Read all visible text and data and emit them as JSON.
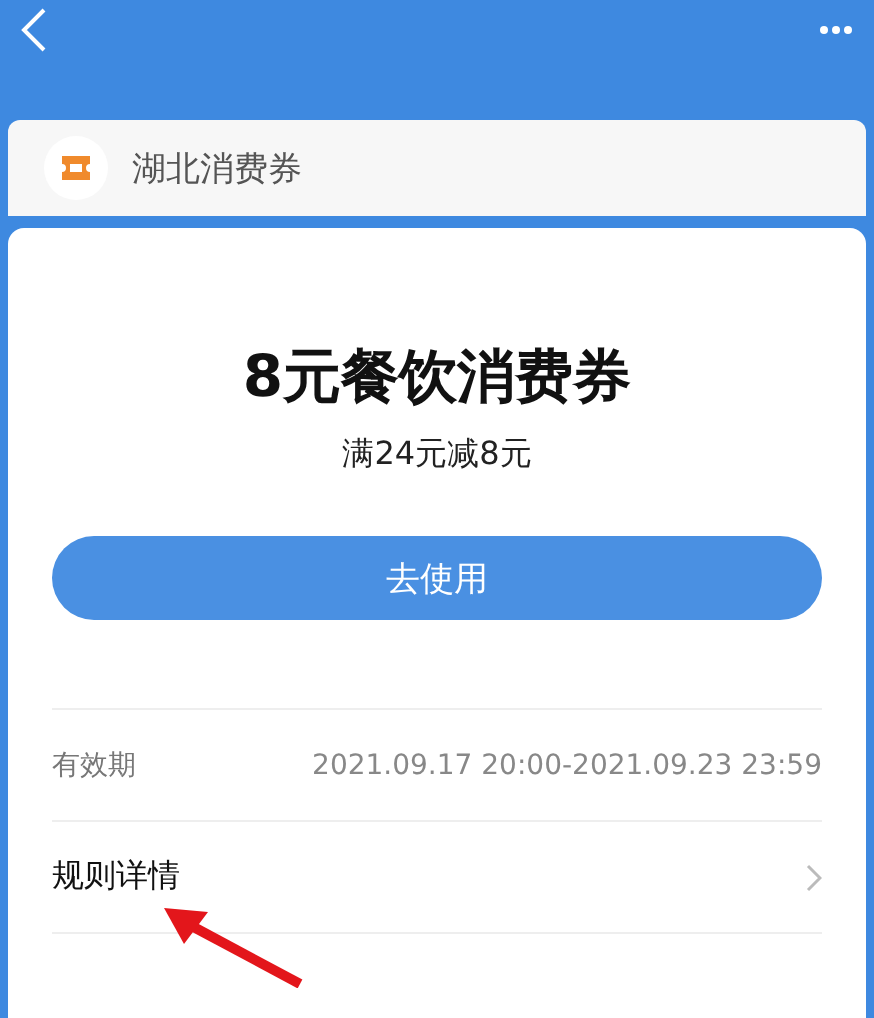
{
  "header": {
    "title": "湖北消费券"
  },
  "coupon": {
    "name": "8元餐饮消费券",
    "condition": "满24元减8元",
    "button": "去使用"
  },
  "rows": [
    {
      "kind": "info",
      "label": "有效期",
      "value": "2021.09.17 20:00-2021.09.23 23:59"
    },
    {
      "kind": "link",
      "label": "规则详情"
    }
  ]
}
